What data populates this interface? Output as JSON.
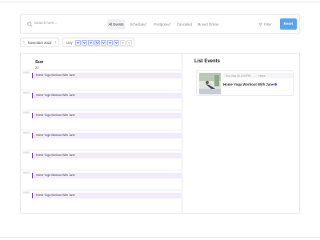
{
  "search": {
    "placeholder": "Search here..."
  },
  "tabs": [
    {
      "label": "All Events",
      "active": true
    },
    {
      "label": "Scheduled",
      "active": false
    },
    {
      "label": "Postponed",
      "active": false
    },
    {
      "label": "Cancelled",
      "active": false
    },
    {
      "label": "Moved Online",
      "active": false
    }
  ],
  "actions": {
    "filter_label": "Filter",
    "reset_label": "Reset"
  },
  "toolbar": {
    "date_label": "November 2022",
    "view_label": "Day"
  },
  "day": {
    "name": "Sun",
    "number": "20"
  },
  "slot_label": "00:00",
  "event_title": "Home Yoga Workout With Jane",
  "list": {
    "title": "List Events",
    "card": {
      "date": "Sun, Nov 20, 5:00 PM",
      "location": "Home",
      "title": "Home Yoga Workout With Jane"
    }
  },
  "colors": {
    "accent": "#7b3fd0",
    "event_bg": "#f1ebfb",
    "reset": "#5aa3f2"
  }
}
